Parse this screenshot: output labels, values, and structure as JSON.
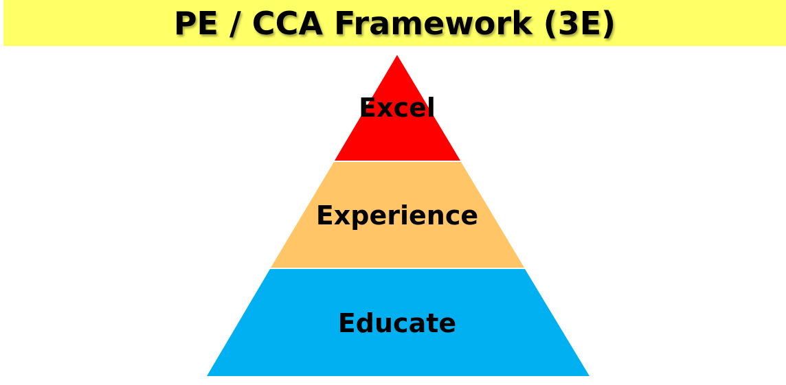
{
  "title": "PE / CCA Framework (3E)",
  "tiers": [
    {
      "label": "Excel",
      "color": "#ff0000"
    },
    {
      "label": "Experience",
      "color": "#ffc567"
    },
    {
      "label": "Educate",
      "color": "#00b0f0"
    }
  ],
  "colors": {
    "title_background": "#ffff66",
    "separator": "#ffffff"
  }
}
